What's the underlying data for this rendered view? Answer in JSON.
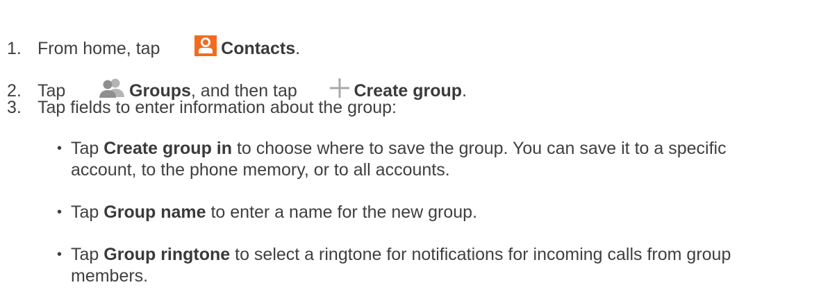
{
  "steps": [
    {
      "number": "1.",
      "before": "From home, tap",
      "icon": "contacts-icon",
      "bold": "Contacts",
      "after": "."
    },
    {
      "number": "2.",
      "before": "Tap",
      "icon1": "groups-icon",
      "bold1": "Groups",
      "middle": ", and then tap",
      "icon2": "plus-icon",
      "bold2": "Create group",
      "after": "."
    },
    {
      "number": "3.",
      "text": "Tap fields to enter information about the group:"
    }
  ],
  "bullets": [
    {
      "before": "Tap ",
      "bold": "Create group in",
      "after": " to choose where to save the group. You can save it to a specific account, to the phone memory, or to all accounts."
    },
    {
      "before": "Tap ",
      "bold": "Group name",
      "after": " to enter a name for the new group."
    },
    {
      "before": "Tap ",
      "bold": "Group ringtone",
      "after": " to select a ringtone for notifications for incoming calls from group members."
    }
  ],
  "colors": {
    "text": "#3f3f3f",
    "contacts_icon_bg": "#f26b21",
    "groups_icon": "#9a9a9a",
    "plus_icon": "#a8a8a8"
  },
  "bullet_glyph": "•"
}
